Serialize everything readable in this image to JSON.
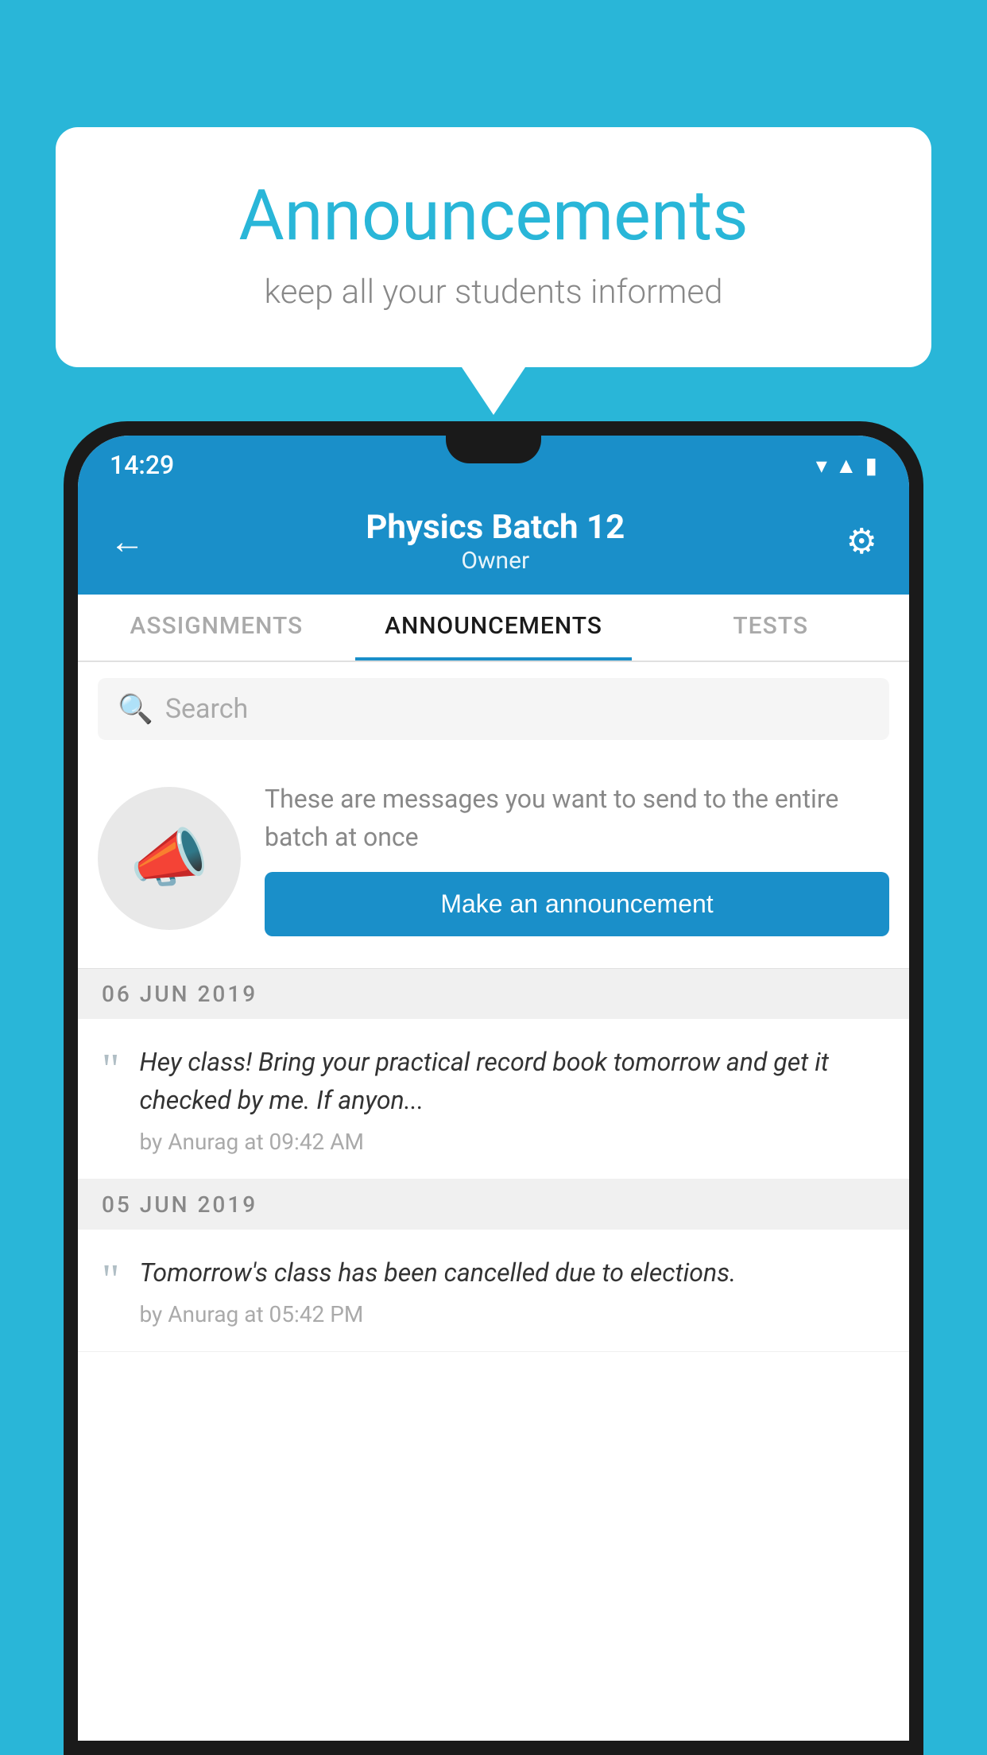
{
  "background_color": "#29b6d8",
  "speech_bubble": {
    "title": "Announcements",
    "subtitle": "keep all your students informed"
  },
  "status_bar": {
    "time": "14:29",
    "icons": [
      "wifi",
      "signal",
      "battery"
    ]
  },
  "app_header": {
    "title": "Physics Batch 12",
    "subtitle": "Owner",
    "back_label": "←",
    "gear_label": "⚙"
  },
  "tabs": [
    {
      "label": "ASSIGNMENTS",
      "active": false
    },
    {
      "label": "ANNOUNCEMENTS",
      "active": true
    },
    {
      "label": "TESTS",
      "active": false
    },
    {
      "label": "...",
      "active": false
    }
  ],
  "search": {
    "placeholder": "Search"
  },
  "promo": {
    "description": "These are messages you want to send to the entire batch at once",
    "button_label": "Make an announcement"
  },
  "announcements": [
    {
      "date": "06  JUN  2019",
      "text": "Hey class! Bring your practical record book tomorrow and get it checked by me. If anyon...",
      "meta": "by Anurag at 09:42 AM"
    },
    {
      "date": "05  JUN  2019",
      "text": "Tomorrow's class has been cancelled due to elections.",
      "meta": "by Anurag at 05:42 PM"
    }
  ]
}
